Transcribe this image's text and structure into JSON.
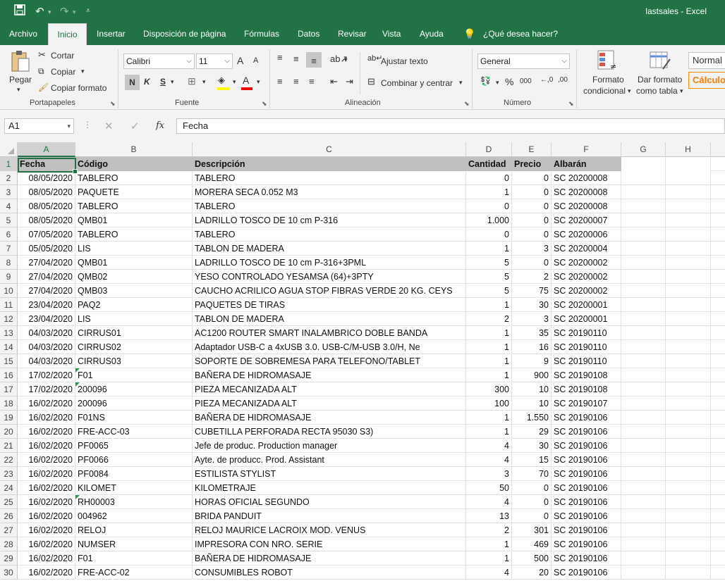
{
  "window": {
    "title": "lastsales  -  Excel"
  },
  "quick_access": {
    "save_icon": "save-icon",
    "undo_icon": "undo-icon",
    "redo_icon": "redo-icon",
    "customize_icon": "chevron-down-icon"
  },
  "tabs": [
    "Archivo",
    "Inicio",
    "Insertar",
    "Disposición de página",
    "Fórmulas",
    "Datos",
    "Revisar",
    "Vista",
    "Ayuda"
  ],
  "tell_me": "¿Qué desea hacer?",
  "ribbon": {
    "clipboard": {
      "paste": "Pegar",
      "cut": "Cortar",
      "copy": "Copiar",
      "format_painter": "Copiar formato",
      "group": "Portapapeles"
    },
    "font": {
      "name": "Calibri",
      "size": "11",
      "grow": "A",
      "shrink": "A",
      "bold": "N",
      "italic": "K",
      "underline": "S",
      "group": "Fuente"
    },
    "alignment": {
      "wrap": "Ajustar texto",
      "merge": "Combinar y centrar",
      "group": "Alineación"
    },
    "number": {
      "format": "General",
      "percent": "%",
      "thousands": "000",
      "inc": "←,0",
      "dec": ",00",
      "group": "Número"
    },
    "styles": {
      "conditional": "Formato",
      "conditional2": "condicional",
      "table": "Dar formato",
      "table2": "como tabla",
      "normal": "Normal",
      "calc": "Cálculo"
    }
  },
  "formula_bar": {
    "name_box": "A1",
    "fx": "fx",
    "content": "Fecha"
  },
  "columns": [
    "A",
    "B",
    "C",
    "D",
    "E",
    "F",
    "G",
    "H"
  ],
  "headers": [
    "Fecha",
    "Código",
    "Descripción",
    "Cantidad",
    "Precio",
    "Albarán"
  ],
  "rows": [
    [
      "08/05/2020",
      "TABLERO",
      "TABLERO",
      "0",
      "0",
      "SC  20200008"
    ],
    [
      "08/05/2020",
      "PAQUETE",
      "MORERA SECA 0.052 M3",
      "1",
      "0",
      "SC  20200008"
    ],
    [
      "08/05/2020",
      "TABLERO",
      "TABLERO",
      "0",
      "0",
      "SC  20200008"
    ],
    [
      "08/05/2020",
      "QMB01",
      "LADRILLO TOSCO DE 10 cm P-316",
      "1.000",
      "0",
      "SC  20200007"
    ],
    [
      "07/05/2020",
      "TABLERO",
      "TABLERO",
      "0",
      "0",
      "SC  20200006"
    ],
    [
      "05/05/2020",
      "LIS",
      "TABLON DE MADERA",
      "1",
      "3",
      "SC  20200004"
    ],
    [
      "27/04/2020",
      "QMB01",
      "LADRILLO TOSCO DE 10 cm P-316+3PML",
      "5",
      "0",
      "SC  20200002"
    ],
    [
      "27/04/2020",
      "QMB02",
      "YESO CONTROLADO YESAMSA (64)+3PTY",
      "5",
      "2",
      "SC  20200002"
    ],
    [
      "27/04/2020",
      "QMB03",
      "CAUCHO ACRILICO AGUA STOP FIBRAS VERDE 20 KG. CEYS",
      "5",
      "75",
      "SC  20200002"
    ],
    [
      "23/04/2020",
      "PAQ2",
      "PAQUETES DE TIRAS",
      "1",
      "30",
      "SC  20200001"
    ],
    [
      "23/04/2020",
      "LIS",
      "TABLON DE MADERA",
      "2",
      "3",
      "SC  20200001"
    ],
    [
      "04/03/2020",
      "CIRRUS01",
      "AC1200 ROUTER SMART INALAMBRICO DOBLE BANDA",
      "1",
      "35",
      "SC  20190110"
    ],
    [
      "04/03/2020",
      "CIRRUS02",
      "Adaptador USB-C a 4xUSB 3.0. USB-C/M-USB 3.0/H, Ne",
      "1",
      "16",
      "SC  20190110"
    ],
    [
      "04/03/2020",
      "CIRRUS03",
      "SOPORTE DE SOBREMESA PARA TELEFONO/TABLET",
      "1",
      "9",
      "SC  20190110"
    ],
    [
      "17/02/2020",
      "F01",
      "BAÑERA DE HIDROMASAJE",
      "1",
      "900",
      "SC  20190108"
    ],
    [
      "17/02/2020",
      "200096",
      "PIEZA MECANIZADA ALT",
      "300",
      "10",
      "SC  20190108"
    ],
    [
      "16/02/2020",
      "200096",
      "PIEZA MECANIZADA ALT",
      "100",
      "10",
      "SC  20190107"
    ],
    [
      "16/02/2020",
      "F01NS",
      "BAÑERA DE HIDROMASAJE",
      "1",
      "1.550",
      "SC  20190106"
    ],
    [
      "16/02/2020",
      "FRE-ACC-03",
      "CUBETILLA PERFORADA RECTA 95030 S3)",
      "1",
      "29",
      "SC  20190106"
    ],
    [
      "16/02/2020",
      "PF0065",
      "Jefe de produc. Production manager",
      "4",
      "30",
      "SC  20190106"
    ],
    [
      "16/02/2020",
      "PF0066",
      "Ayte. de producc. Prod. Assistant",
      "4",
      "15",
      "SC  20190106"
    ],
    [
      "16/02/2020",
      "PF0084",
      "ESTILISTA  STYLIST",
      "3",
      "70",
      "SC  20190106"
    ],
    [
      "16/02/2020",
      "KILOMET",
      "KILOMETRAJE",
      "50",
      "0",
      "SC  20190106"
    ],
    [
      "16/02/2020",
      "RH00003",
      "HORAS OFICIAL SEGUNDO",
      "4",
      "0",
      "SC  20190106"
    ],
    [
      "16/02/2020",
      "004962",
      "BRIDA PANDUIT",
      "13",
      "0",
      "SC  20190106"
    ],
    [
      "16/02/2020",
      "RELOJ",
      "RELOJ MAURICE LACROIX MOD. VENUS",
      "2",
      "301",
      "SC  20190106"
    ],
    [
      "16/02/2020",
      "NUMSER",
      "IMPRESORA CON NRO. SERIE",
      "1",
      "469",
      "SC  20190106"
    ],
    [
      "16/02/2020",
      "F01",
      "BAÑERA DE HIDROMASAJE",
      "1",
      "500",
      "SC  20190106"
    ],
    [
      "16/02/2020",
      "FRE-ACC-02",
      "CONSUMIBLES ROBOT",
      "4",
      "20",
      "SC  20190106"
    ]
  ],
  "text_number_rows": [
    16,
    17,
    25
  ],
  "colors": {
    "excel_green": "#217346",
    "header_fill": "#c0c0c0",
    "ribbon_bg": "#f3f3f3"
  }
}
